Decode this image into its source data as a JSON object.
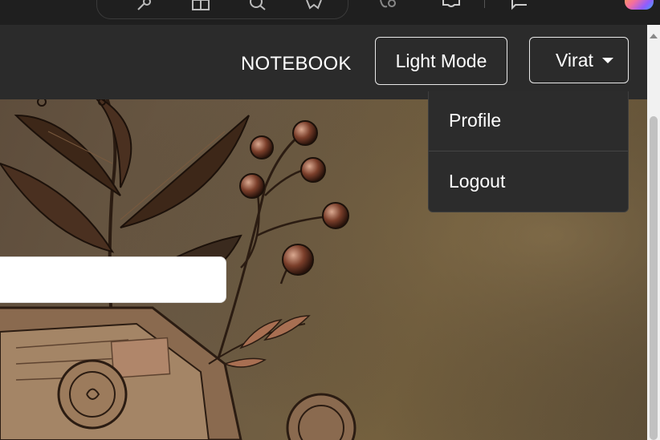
{
  "browser": {
    "icons": [
      "key-icon",
      "reader-icon",
      "zoom-icon",
      "favorite-star-icon",
      "extensions-icon",
      "puzzle-icon",
      "feedback-icon",
      "copilot-icon"
    ]
  },
  "navbar": {
    "brand": "NOTEBOOK",
    "mode_toggle_label": "Light Mode",
    "user_name": "Virat"
  },
  "user_menu": {
    "items": [
      {
        "label": "Profile"
      },
      {
        "label": "Logout"
      }
    ]
  },
  "search": {
    "value": ""
  },
  "colors": {
    "navbar_bg": "#2b2b2b",
    "dropdown_bg": "#2c2c2c",
    "hero_tone": "#6b5a44",
    "border": "#e8e8e8"
  }
}
